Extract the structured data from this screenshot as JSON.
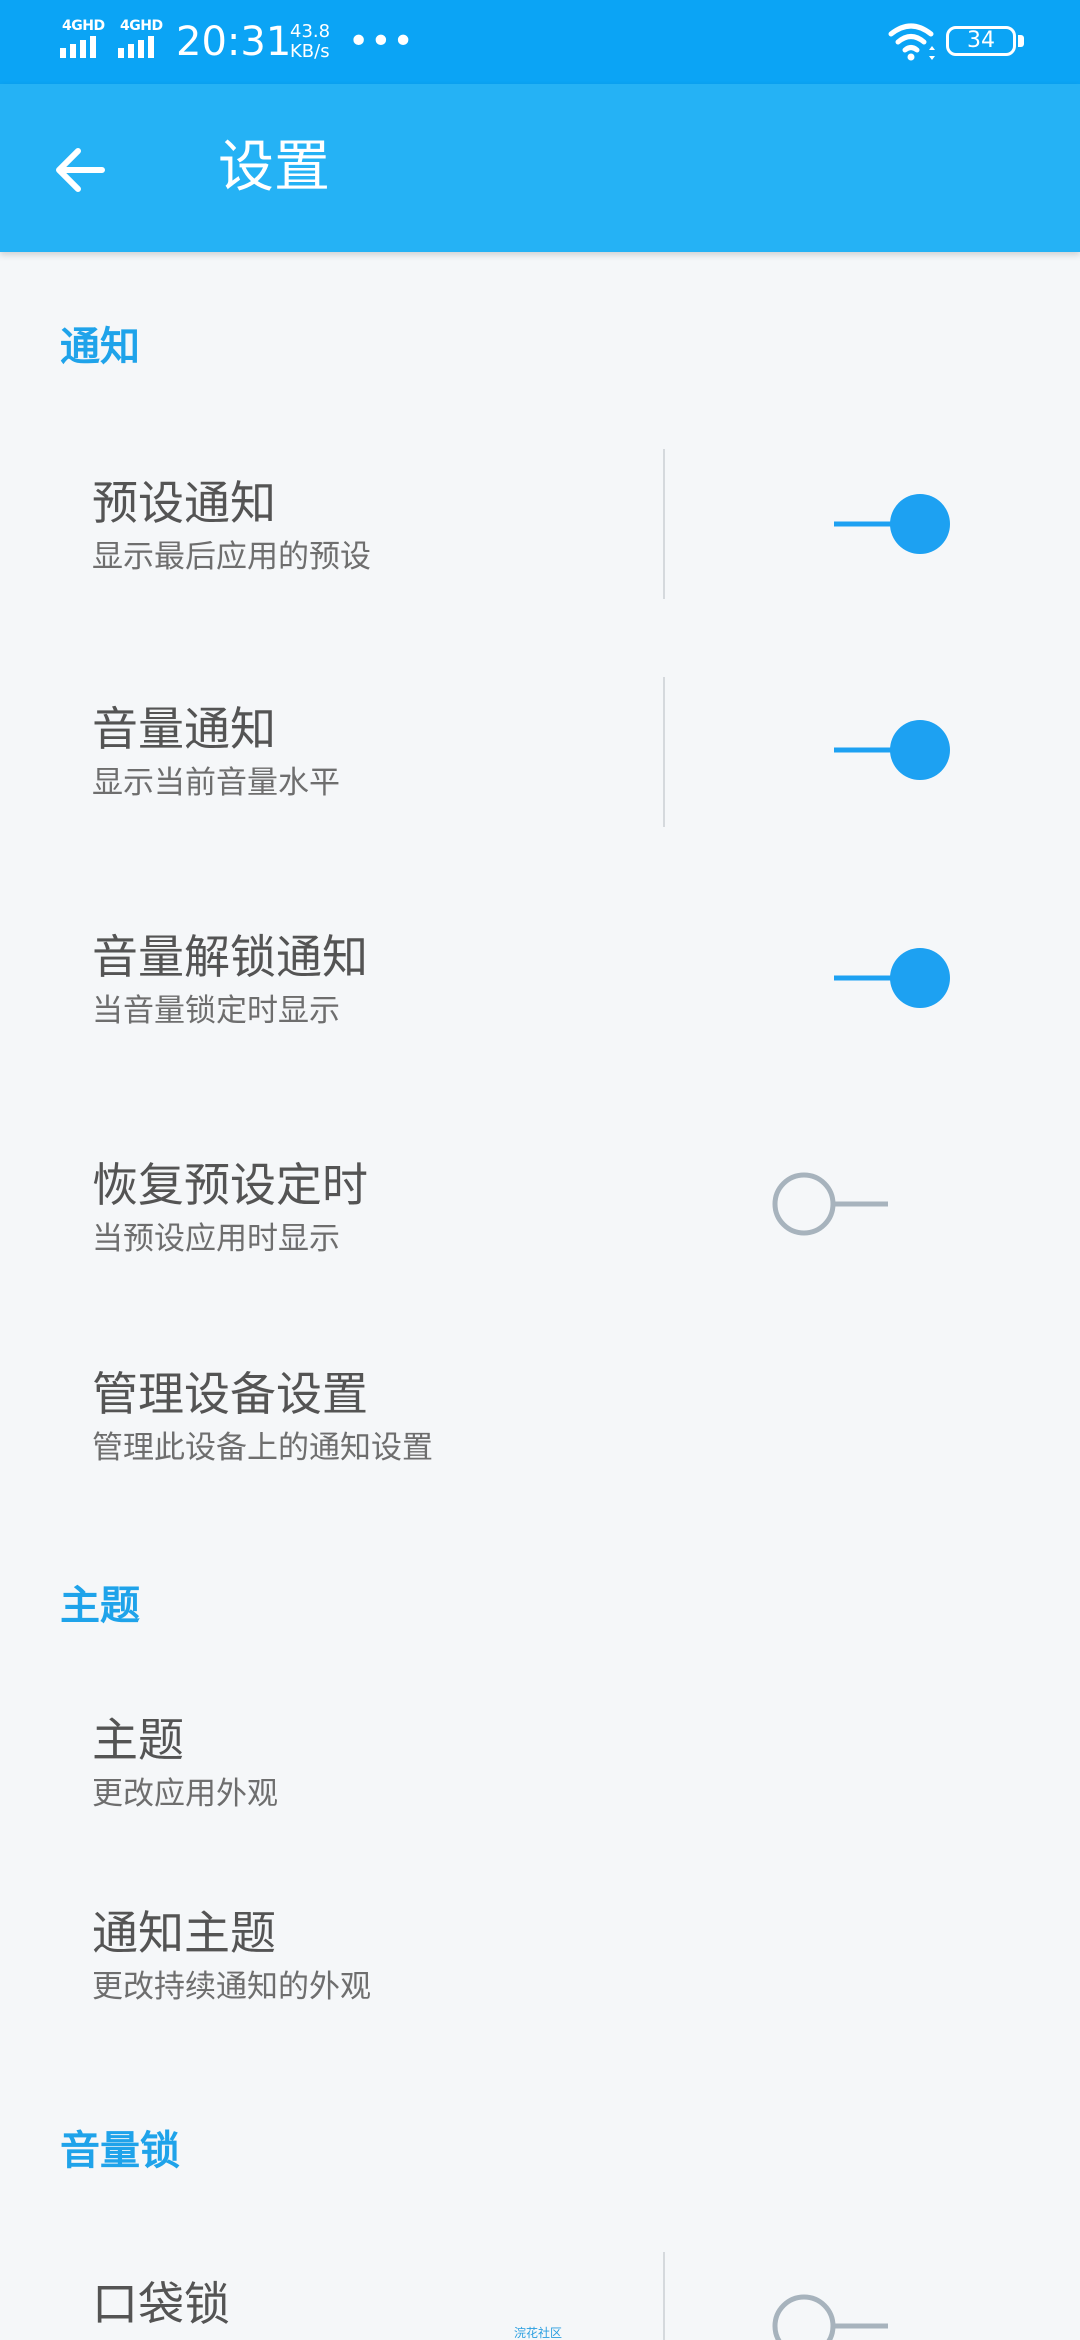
{
  "status_bar": {
    "network_1": "4GHD",
    "network_2": "4GHD",
    "time": "20:31",
    "speed_value": "43.8",
    "speed_unit": "KB/s",
    "more": "•••",
    "battery": "34"
  },
  "toolbar": {
    "title": "设置",
    "back_icon": "arrow-left-icon"
  },
  "sections": {
    "notifications": {
      "header": "通知",
      "preset_notification": {
        "title": "预设通知",
        "summary": "显示最后应用的预设",
        "enabled": true
      },
      "volume_notification": {
        "title": "音量通知",
        "summary": "显示当前音量水平",
        "enabled": true
      },
      "volume_unlock_notification": {
        "title": "音量解锁通知",
        "summary": "当音量锁定时显示",
        "enabled": true
      },
      "restore_preset_timer": {
        "title": "恢复预设定时",
        "summary": "当预设应用时显示",
        "enabled": false
      },
      "manage_device_settings": {
        "title": "管理设备设置",
        "summary": "管理此设备上的通知设置"
      }
    },
    "theme": {
      "header": "主题",
      "theme_item": {
        "title": "主题",
        "summary": "更改应用外观"
      },
      "notification_theme": {
        "title": "通知主题",
        "summary": "更改持续通知的外观"
      }
    },
    "volume_lock": {
      "header": "音量锁",
      "pocket_lock": {
        "title": "口袋锁",
        "enabled": false
      }
    }
  },
  "watermark": "浣花社区",
  "colors": {
    "status_bar": "#0ba4f5",
    "toolbar": "#25b2f5",
    "accent": "#1fa3ea",
    "switch_on": "#1da1f2",
    "switch_off": "#a7b3bd",
    "background": "#f5f7f9"
  }
}
